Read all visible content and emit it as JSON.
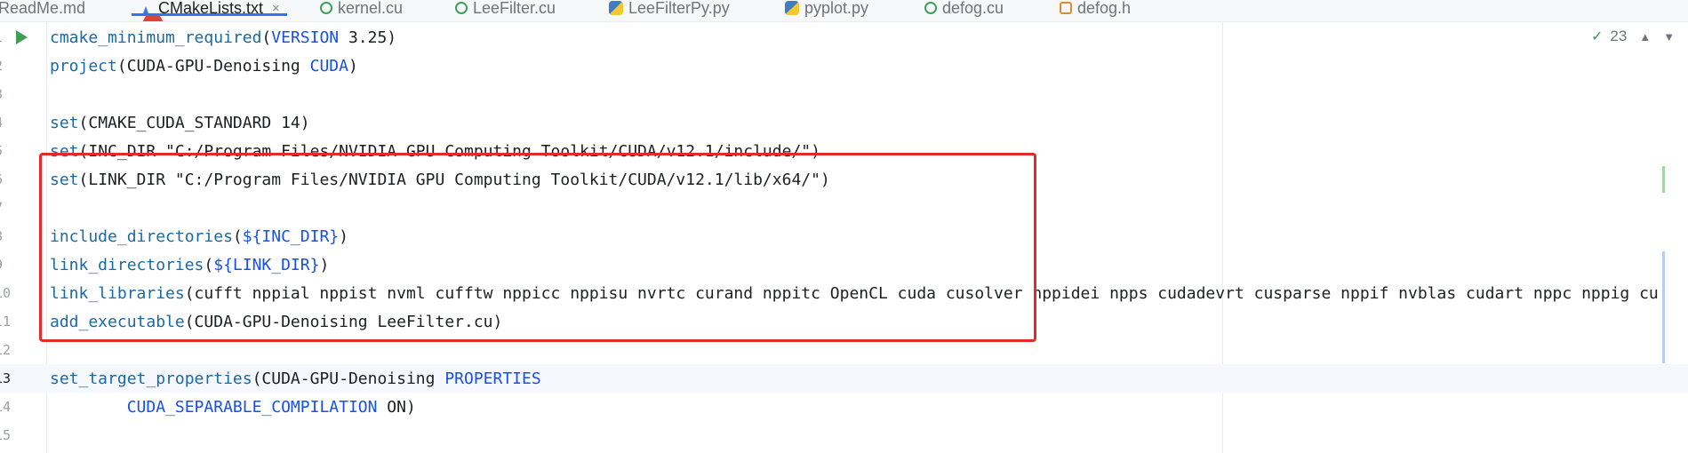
{
  "tabs": [
    {
      "label": "ReadMe.md",
      "icon": "markdown-icon",
      "active": false
    },
    {
      "label": "CMakeLists.txt",
      "icon": "cmake-icon",
      "active": true
    },
    {
      "label": "kernel.cu",
      "icon": "cuda-file-icon",
      "active": false
    },
    {
      "label": "LeeFilter.cu",
      "icon": "cuda-file-icon",
      "active": false
    },
    {
      "label": "LeeFilterPy.py",
      "icon": "python-icon",
      "active": false
    },
    {
      "label": "pyplot.py",
      "icon": "python-icon",
      "active": false
    },
    {
      "label": "defog.cu",
      "icon": "cuda-file-icon",
      "active": false
    },
    {
      "label": "defog.h",
      "icon": "header-file-icon",
      "active": false
    }
  ],
  "tab_close": "×",
  "inspection": {
    "count": "23",
    "check": "✓"
  },
  "line_numbers": [
    "1",
    "2",
    "3",
    "4",
    "5",
    "6",
    "7",
    "8",
    "9",
    "10",
    "11",
    "12",
    "13",
    "14",
    "15"
  ],
  "code": {
    "l1_fn": "cmake_minimum_required",
    "l1_kw": "VERSION",
    "l1_rest": " 3.25)",
    "l2_fn": "project",
    "l2_arg": "(CUDA-GPU-Denoising ",
    "l2_kw": "CUDA",
    "l2_rest": ")",
    "l4_fn": "set",
    "l4_rest": "(CMAKE_CUDA_STANDARD 14)",
    "l5_fn": "set",
    "l5_rest": "(INC_DIR \"C:/Program Files/NVIDIA GPU Computing Toolkit/CUDA/v12.1/include/\")",
    "l6_fn": "set",
    "l6_rest": "(LINK_DIR \"C:/Program Files/NVIDIA GPU Computing Toolkit/CUDA/v12.1/lib/x64/\")",
    "l8_fn": "include_directories",
    "l8_var": "${INC_DIR}",
    "l9_fn": "link_directories",
    "l9_var": "${LINK_DIR}",
    "l10_fn": "link_libraries",
    "l10_rest": "(cufft nppial nppist nvml cufftw nppicc nppisu nvrtc curand nppitc OpenCL cuda cusolver nppidei npps cudadevrt cusparse nppif nvblas cudart nppc nppig cu",
    "l11_fn": "add_executable",
    "l11_rest": "(CUDA-GPU-Denoising LeeFilter.cu)",
    "l13_fn": "set_target_properties",
    "l13_arg": "(CUDA-GPU-Denoising ",
    "l13_kw": "PROPERTIES",
    "l14_indent": "        ",
    "l14_kw": "CUDA_SEPARABLE_COMPILATION",
    "l14_rest": " ON)"
  }
}
